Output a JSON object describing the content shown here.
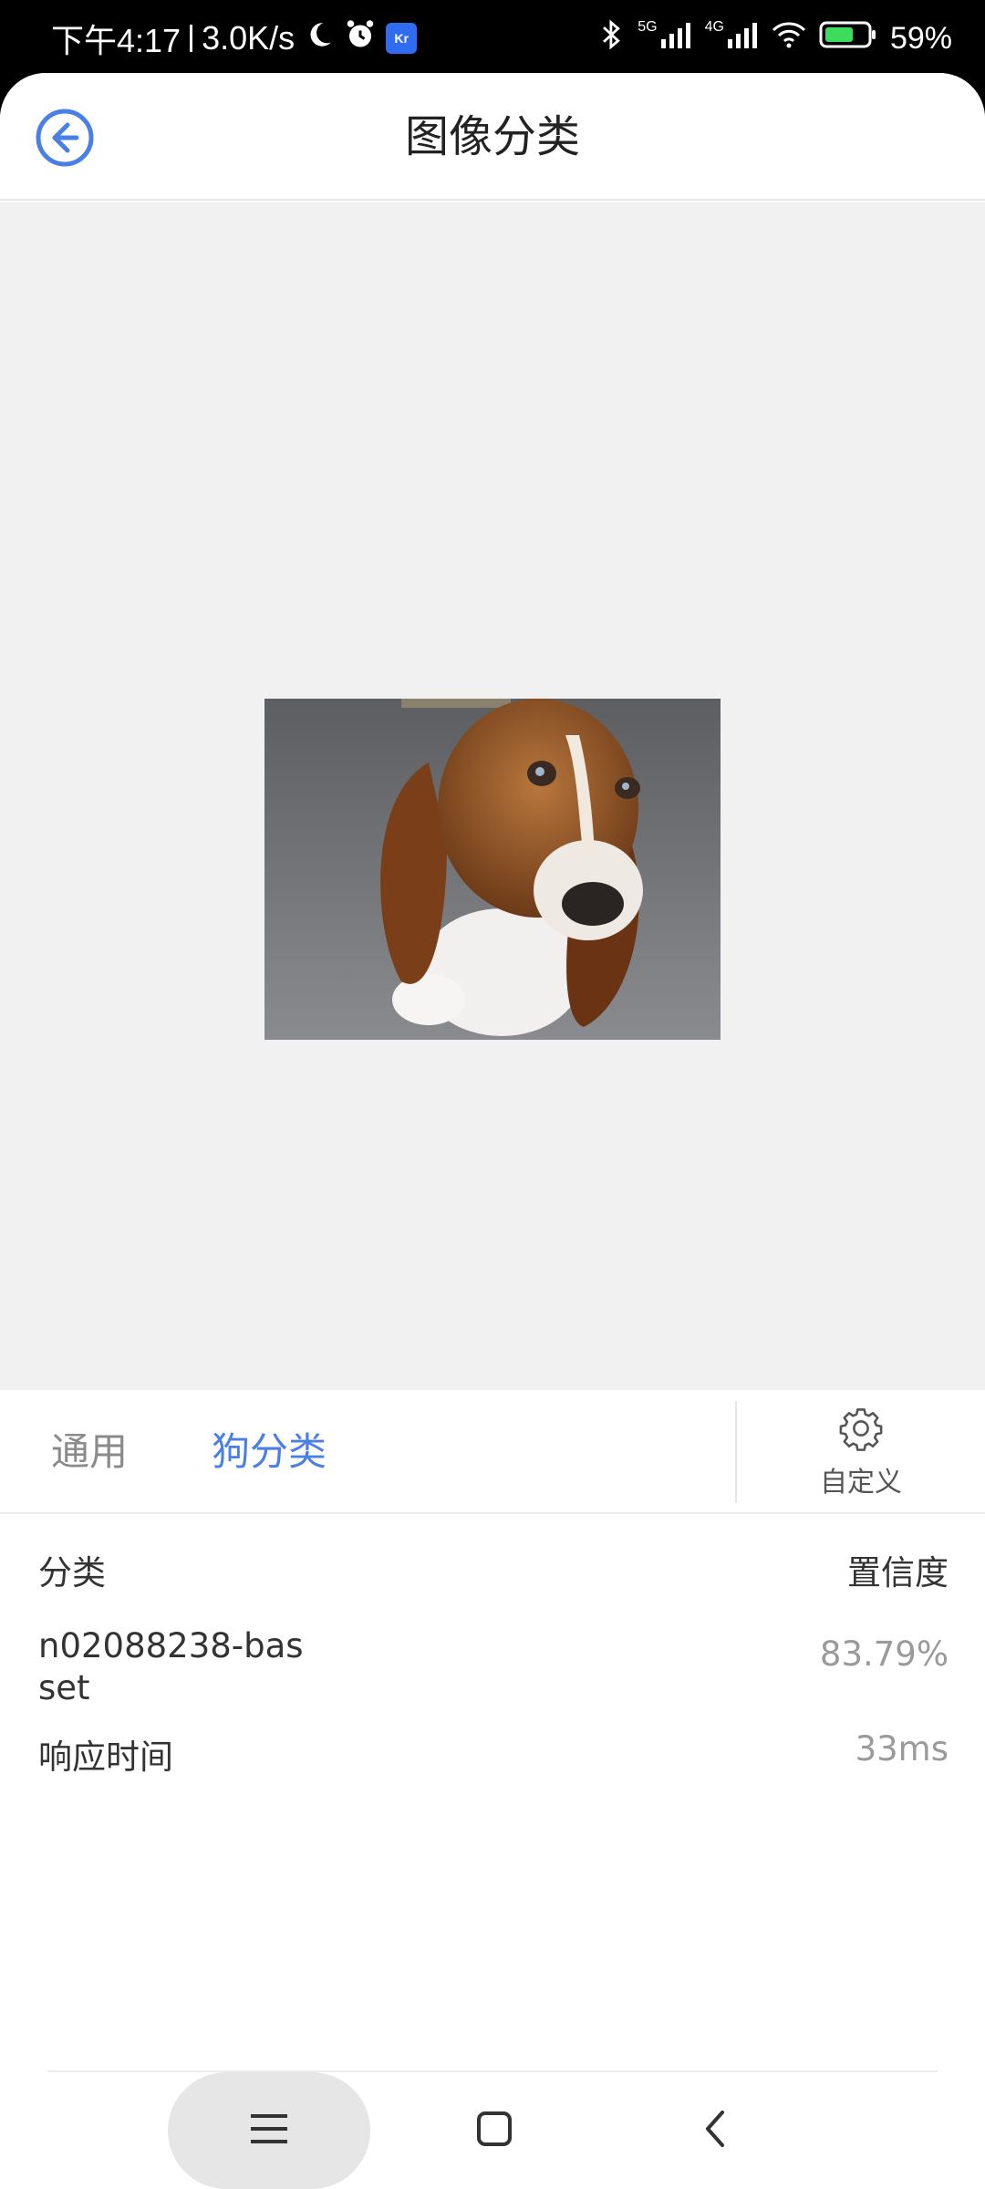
{
  "status_bar": {
    "time": "下午4:17",
    "speed": "3.0K/s",
    "network_1": "5G",
    "network_2": "4G",
    "battery": "59%"
  },
  "header": {
    "title": "图像分类"
  },
  "tabs": [
    {
      "label": "通用",
      "active": false
    },
    {
      "label": "狗分类",
      "active": true
    }
  ],
  "custom_button": {
    "label": "自定义"
  },
  "results": {
    "headers": {
      "class": "分类",
      "confidence": "置信度"
    },
    "rows": [
      {
        "label": "n02088238-basset",
        "value": "83.79%"
      }
    ],
    "response": {
      "label": "响应时间",
      "value": "33ms"
    }
  },
  "colors": {
    "accent": "#4a7fe6",
    "background": "#f1f1f1"
  },
  "icons": [
    "back-arrow-icon",
    "gear-icon",
    "menu-icon",
    "home-icon",
    "nav-back-icon",
    "moon-icon",
    "alarm-icon",
    "bluetooth-icon",
    "signal-icon",
    "wifi-icon",
    "battery-icon"
  ]
}
